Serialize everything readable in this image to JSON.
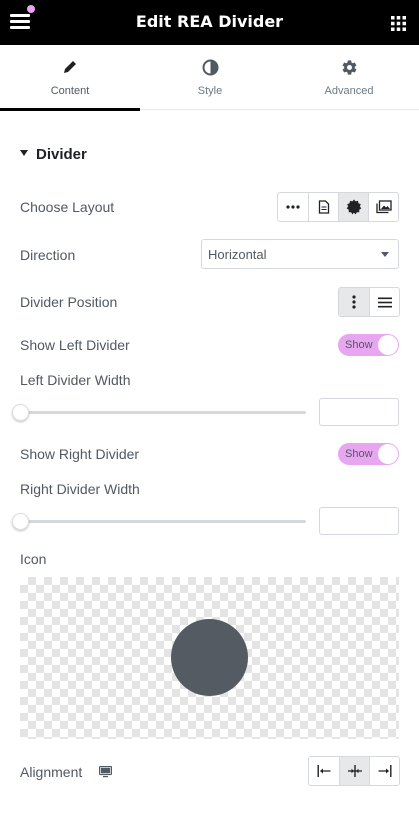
{
  "header": {
    "title": "Edit REA Divider",
    "menu_icon": "hamburger-icon",
    "apps_icon": "grid-icon",
    "notification_color": "#e8a6f1"
  },
  "tabs": [
    {
      "label": "Content",
      "icon": "pencil-icon",
      "active": true
    },
    {
      "label": "Style",
      "icon": "half-circle-icon",
      "active": false
    },
    {
      "label": "Advanced",
      "icon": "gear-icon",
      "active": false
    }
  ],
  "section": {
    "title": "Divider",
    "expanded": true
  },
  "controls": {
    "choose_layout": {
      "label": "Choose Layout",
      "options": [
        "dots-icon",
        "document-icon",
        "badge-icon",
        "images-icon"
      ],
      "selected": "badge-icon"
    },
    "direction": {
      "label": "Direction",
      "value": "Horizontal"
    },
    "divider_position": {
      "label": "Divider Position",
      "options": [
        "vertical-dots-icon",
        "horizontal-lines-icon"
      ],
      "selected": "vertical-dots-icon"
    },
    "show_left_divider": {
      "label": "Show Left Divider",
      "toggle_text": "Show",
      "on": true
    },
    "left_divider_width": {
      "label": "Left Divider Width",
      "slider_value": 0,
      "input_value": ""
    },
    "show_right_divider": {
      "label": "Show Right Divider",
      "toggle_text": "Show",
      "on": true
    },
    "right_divider_width": {
      "label": "Right Divider Width",
      "slider_value": 0,
      "input_value": ""
    },
    "icon": {
      "label": "Icon",
      "preview_color": "#555b63"
    },
    "alignment": {
      "label": "Alignment",
      "responsive_icon": "desktop-icon",
      "options": [
        "align-left-icon",
        "align-center-icon",
        "align-right-icon"
      ],
      "selected": "align-center-icon"
    }
  },
  "colors": {
    "accent": "#e8a6f1",
    "header_bg": "#000000",
    "text": "#515962"
  }
}
